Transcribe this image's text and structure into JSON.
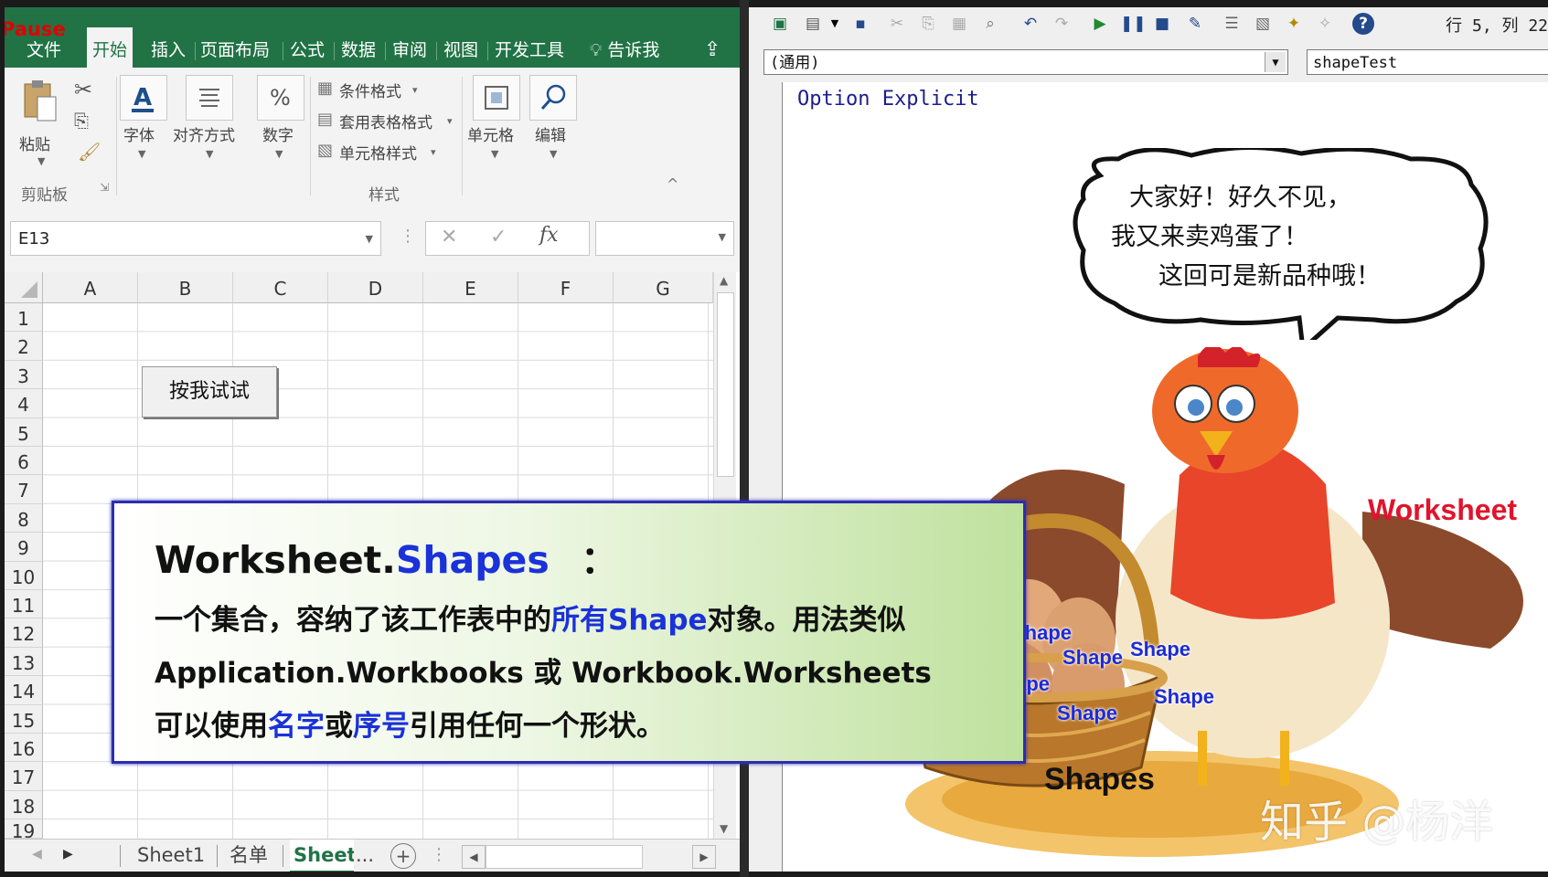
{
  "excel": {
    "pause_label": "Pause",
    "ribbon_tabs": [
      "文件",
      "开始",
      "插入",
      "页面布局",
      "公式",
      "数据",
      "审阅",
      "视图",
      "开发工具",
      "告诉我"
    ],
    "ribbon": {
      "paste": "粘贴",
      "clipboard_group": "剪贴板",
      "font": "字体",
      "alignment": "对齐方式",
      "number": "数字",
      "conditional_format": "条件格式",
      "table_format": "套用表格格式",
      "cell_style": "单元格样式",
      "styles_group": "样式",
      "cells": "单元格",
      "editing": "编辑"
    },
    "name_box": "E13",
    "columns": [
      "A",
      "B",
      "C",
      "D",
      "E",
      "F",
      "G"
    ],
    "rows": [
      "1",
      "2",
      "3",
      "4",
      "5",
      "6",
      "7",
      "8",
      "9",
      "10",
      "11",
      "12",
      "13",
      "14",
      "15",
      "16",
      "17",
      "18",
      "19"
    ],
    "button_label": "按我试试",
    "sheet_tabs": [
      "Sheet1",
      "名单",
      "Sheet"
    ],
    "ellipsis": "..."
  },
  "vbe": {
    "position_readout": "行 5, 列 22",
    "object_combo": "(通用)",
    "procedure_combo": "shapeTest",
    "code_line": "Option Explicit"
  },
  "slide": {
    "title_a": "Worksheet.",
    "title_b": "Shapes",
    "title_c": "：",
    "line1_a": "一个集合，容纳了该工作表中的",
    "line1_b": "所有Shape",
    "line1_c": "对象。用法类似",
    "line2": "Application.Workbooks 或 Workbook.Worksheets",
    "line3_a": "可以使用",
    "line3_b": "名字",
    "line3_c": "或",
    "line3_d": "序号",
    "line3_e": "引用任何一个形状。",
    "speech": [
      "大家好！好久不见，",
      "我又来卖鸡蛋了！",
      "这回可是新品种哦！"
    ],
    "worksheet_label": "Worksheet",
    "egg_label": "Shape",
    "basket_label": "Shapes",
    "watermark": "知乎 @杨洋"
  },
  "colors": {
    "excel_green": "#217346",
    "accent_blue": "#1a32d8",
    "worksheet_red": "#e0142c"
  }
}
